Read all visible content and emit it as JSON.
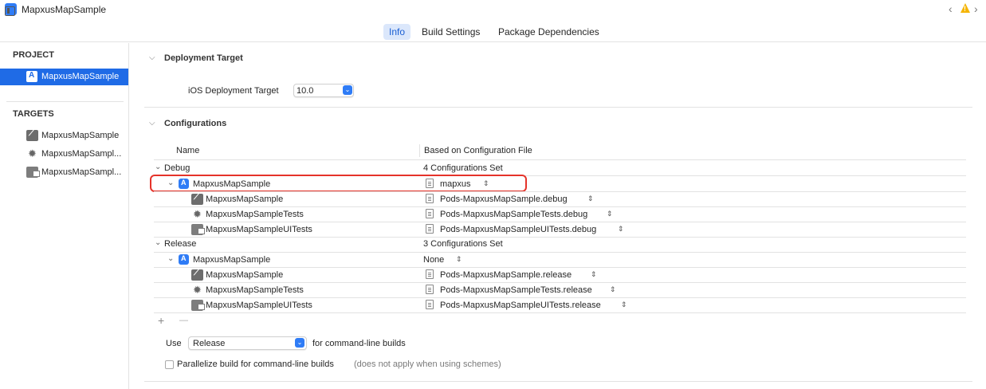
{
  "window": {
    "title": "MapxusMapSample",
    "nav_back": "‹",
    "nav_forward": "›",
    "warning_mark": "!"
  },
  "tabs": {
    "info": "Info",
    "build_settings": "Build Settings",
    "package_dependencies": "Package Dependencies"
  },
  "sidebar": {
    "project_heading": "PROJECT",
    "project_item": "MapxusMapSample",
    "targets_heading": "TARGETS",
    "targets": [
      {
        "label": "MapxusMapSample",
        "icon": "app-target-icon"
      },
      {
        "label": "MapxusMapSampl...",
        "icon": "test-target-icon"
      },
      {
        "label": "MapxusMapSampl...",
        "icon": "ui-test-target-icon"
      }
    ]
  },
  "deployment": {
    "heading": "Deployment Target",
    "ios_label": "iOS Deployment Target",
    "ios_value": "10.0"
  },
  "configurations": {
    "heading": "Configurations",
    "col_name": "Name",
    "col_based_on": "Based on Configuration File",
    "debug": {
      "label": "Debug",
      "summary": "4 Configurations Set",
      "project": {
        "name": "MapxusMapSample",
        "file": "mapxus"
      },
      "targets": [
        {
          "name": "MapxusMapSample",
          "file": "Pods-MapxusMapSample.debug"
        },
        {
          "name": "MapxusMapSampleTests",
          "file": "Pods-MapxusMapSampleTests.debug"
        },
        {
          "name": "MapxusMapSampleUITests",
          "file": "Pods-MapxusMapSampleUITests.debug"
        }
      ]
    },
    "release": {
      "label": "Release",
      "summary": "3 Configurations Set",
      "project": {
        "name": "MapxusMapSample",
        "file": "None"
      },
      "targets": [
        {
          "name": "MapxusMapSample",
          "file": "Pods-MapxusMapSample.release"
        },
        {
          "name": "MapxusMapSampleTests",
          "file": "Pods-MapxusMapSampleTests.release"
        },
        {
          "name": "MapxusMapSampleUITests",
          "file": "Pods-MapxusMapSampleUITests.release"
        }
      ]
    },
    "add_button": "+",
    "remove_button": "—",
    "use_label": "Use",
    "use_value": "Release",
    "use_suffix": "for command-line builds",
    "parallelize_label": "Parallelize build for command-line builds",
    "parallelize_note": "(does not apply when using schemes)",
    "parallelize_checked": false
  },
  "colors": {
    "accent": "#1f6be6",
    "highlight_box": "#e5332a",
    "warning": "#f5b400"
  }
}
